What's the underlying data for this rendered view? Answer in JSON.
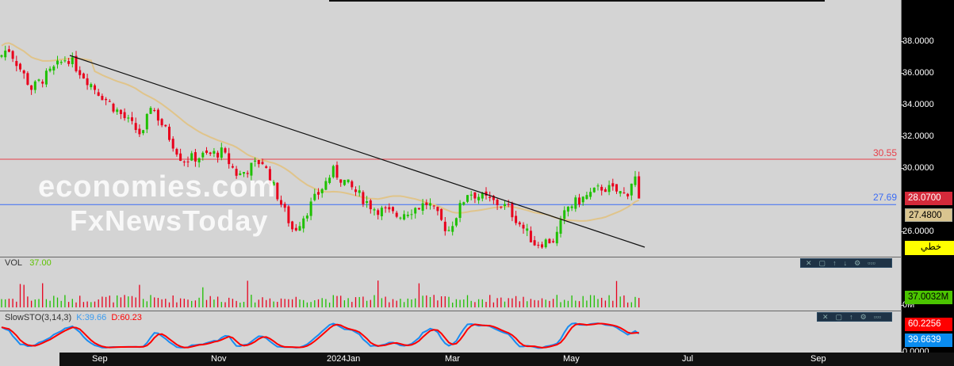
{
  "price_axis": {
    "ticks": [
      "38.0000",
      "36.0000",
      "34.0000",
      "32.0000",
      "30.0000",
      "26.0000"
    ],
    "tick_values": [
      38,
      36,
      34,
      32,
      30,
      26
    ]
  },
  "levels": {
    "resistance": "30.55",
    "support": "27.69",
    "resistance_value": 30.55,
    "support_value": 27.69,
    "resistance_color": "#e8404a",
    "support_color": "#3b6cf5"
  },
  "tags": {
    "last_price": "28.0700",
    "ma_value": "27.4800",
    "chart_type": "خطي",
    "volume": "37.0032M",
    "volume_zero": "0M",
    "stoch_d": "60.2256",
    "stoch_k": "39.6639",
    "stoch_zero": "0.0000"
  },
  "volume_pane": {
    "label": "VOL",
    "value": "37.00"
  },
  "stoch_pane": {
    "label": "SlowSTO(3,14,3)",
    "k": "K:39.66",
    "d": "D:60.23"
  },
  "time_axis": [
    "Sep",
    "Nov",
    "2024Jan",
    "Mar",
    "May",
    "Jul",
    "Sep"
  ],
  "watermark": {
    "line1": "economies.com",
    "line2": "FxNewsToday"
  },
  "toolbar_icons": [
    "close-icon",
    "maximize-icon",
    "move-up-icon",
    "move-down-icon",
    "settings-icon",
    "more-icon"
  ],
  "chart": {
    "price_path": [
      37,
      37.6,
      35,
      37,
      35,
      32,
      34,
      30.5,
      31,
      29.5,
      30.5,
      26,
      29.8,
      27.5,
      27,
      27.8,
      26,
      28.5,
      27.5,
      25.2,
      25.5,
      27.5,
      28.8,
      28.3,
      29.6,
      28.07
    ]
  }
}
